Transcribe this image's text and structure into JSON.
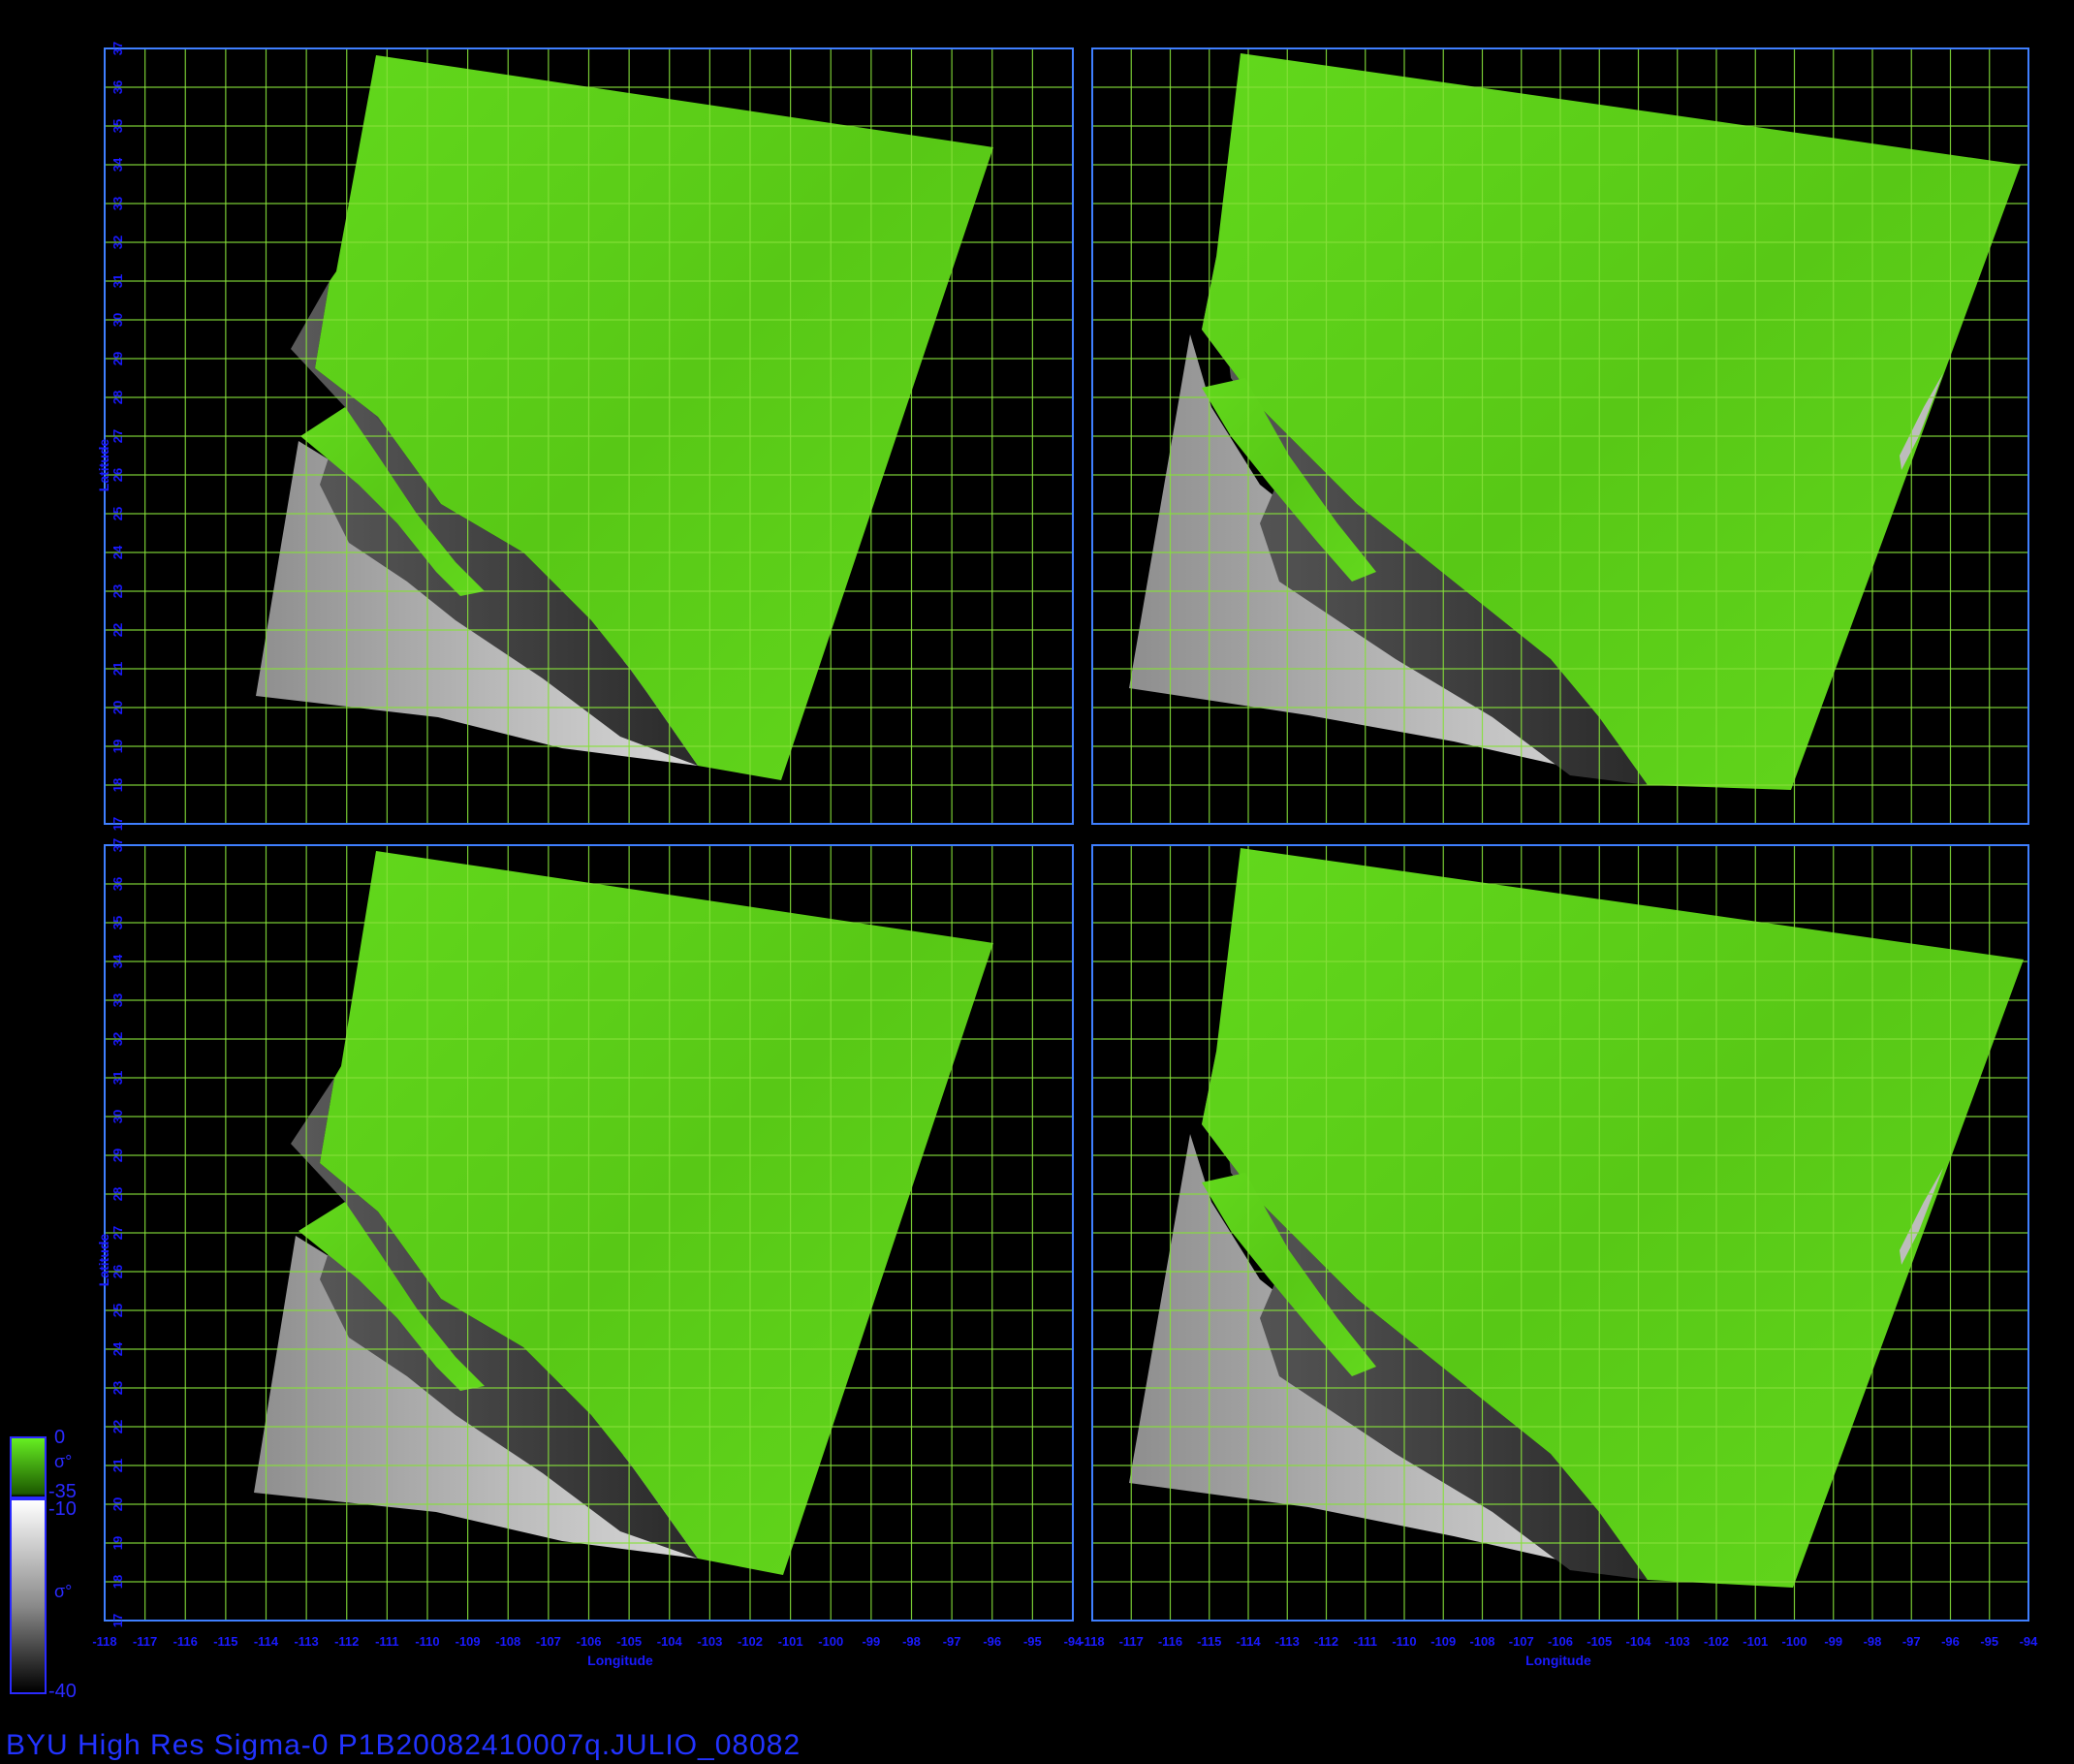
{
  "footer": {
    "title": "BYU  High  Res  Sigma-0  P1B20082410007q.JULIO_08082"
  },
  "legend": {
    "green_top": "0",
    "green_symbol": "σ°",
    "green_bottom": "-35",
    "gray_top": "-10",
    "gray_symbol": "σ°",
    "gray_bottom": "-40"
  },
  "axes": {
    "xlabel": "Longitude",
    "ylabel": "Latitude",
    "lat_ticks": [
      "17",
      "18",
      "19",
      "20",
      "21",
      "22",
      "23",
      "24",
      "25",
      "26",
      "27",
      "28",
      "29",
      "30",
      "31",
      "32",
      "33",
      "34",
      "35",
      "36",
      "37"
    ],
    "lon_ticks_left": [
      "-118",
      "-117",
      "-116",
      "-115",
      "-114",
      "-113",
      "-112",
      "-111",
      "-110",
      "-109",
      "-108",
      "-107",
      "-106",
      "-105",
      "-104",
      "-103",
      "-102",
      "-101",
      "-100",
      "-99",
      "-98",
      "-97",
      "-96",
      "-95",
      "-94"
    ],
    "lon_ticks_right": [
      "-118",
      "-117",
      "-116",
      "-115",
      "-114",
      "-113",
      "-112",
      "-111",
      "-110",
      "-109",
      "-108",
      "-107",
      "-106",
      "-105",
      "-104",
      "-103",
      "-102",
      "-101",
      "-100",
      "-99",
      "-98",
      "-97",
      "-96",
      "-95",
      "-94"
    ]
  },
  "colors": {
    "land": "#5fd61a",
    "grid": "#86e03a",
    "frame": "#3f7fff",
    "label": "#1a1aff"
  }
}
